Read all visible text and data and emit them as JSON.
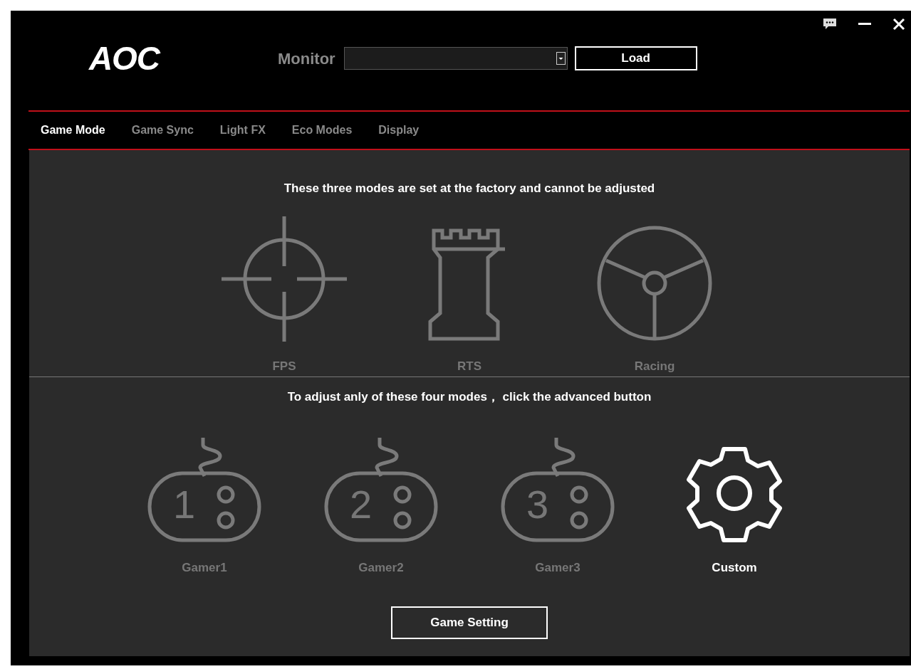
{
  "logo": "AOC",
  "monitor": {
    "label": "Monitor",
    "load_button": "Load"
  },
  "tabs": [
    {
      "label": "Game Mode",
      "selected": true
    },
    {
      "label": "Game Sync",
      "selected": false
    },
    {
      "label": "Light FX",
      "selected": false
    },
    {
      "label": "Eco Modes",
      "selected": false
    },
    {
      "label": "Display",
      "selected": false
    }
  ],
  "factory_section": {
    "heading": "These three modes are set at the factory and cannot be adjusted",
    "modes": [
      {
        "kind": "crosshair",
        "label": "FPS",
        "selected": false
      },
      {
        "kind": "tower",
        "label": "RTS",
        "selected": false
      },
      {
        "kind": "wheel",
        "label": "Racing",
        "selected": false
      }
    ]
  },
  "custom_section": {
    "heading": "To adjust anly of these four modes， click the advanced button",
    "modes": [
      {
        "kind": "controller",
        "number": "1",
        "label": "Gamer1",
        "selected": false
      },
      {
        "kind": "controller",
        "number": "2",
        "label": "Gamer2",
        "selected": false
      },
      {
        "kind": "controller",
        "number": "3",
        "label": "Gamer3",
        "selected": false
      },
      {
        "kind": "gear",
        "label": "Custom",
        "selected": true
      }
    ]
  },
  "game_setting_button": "Game Setting"
}
